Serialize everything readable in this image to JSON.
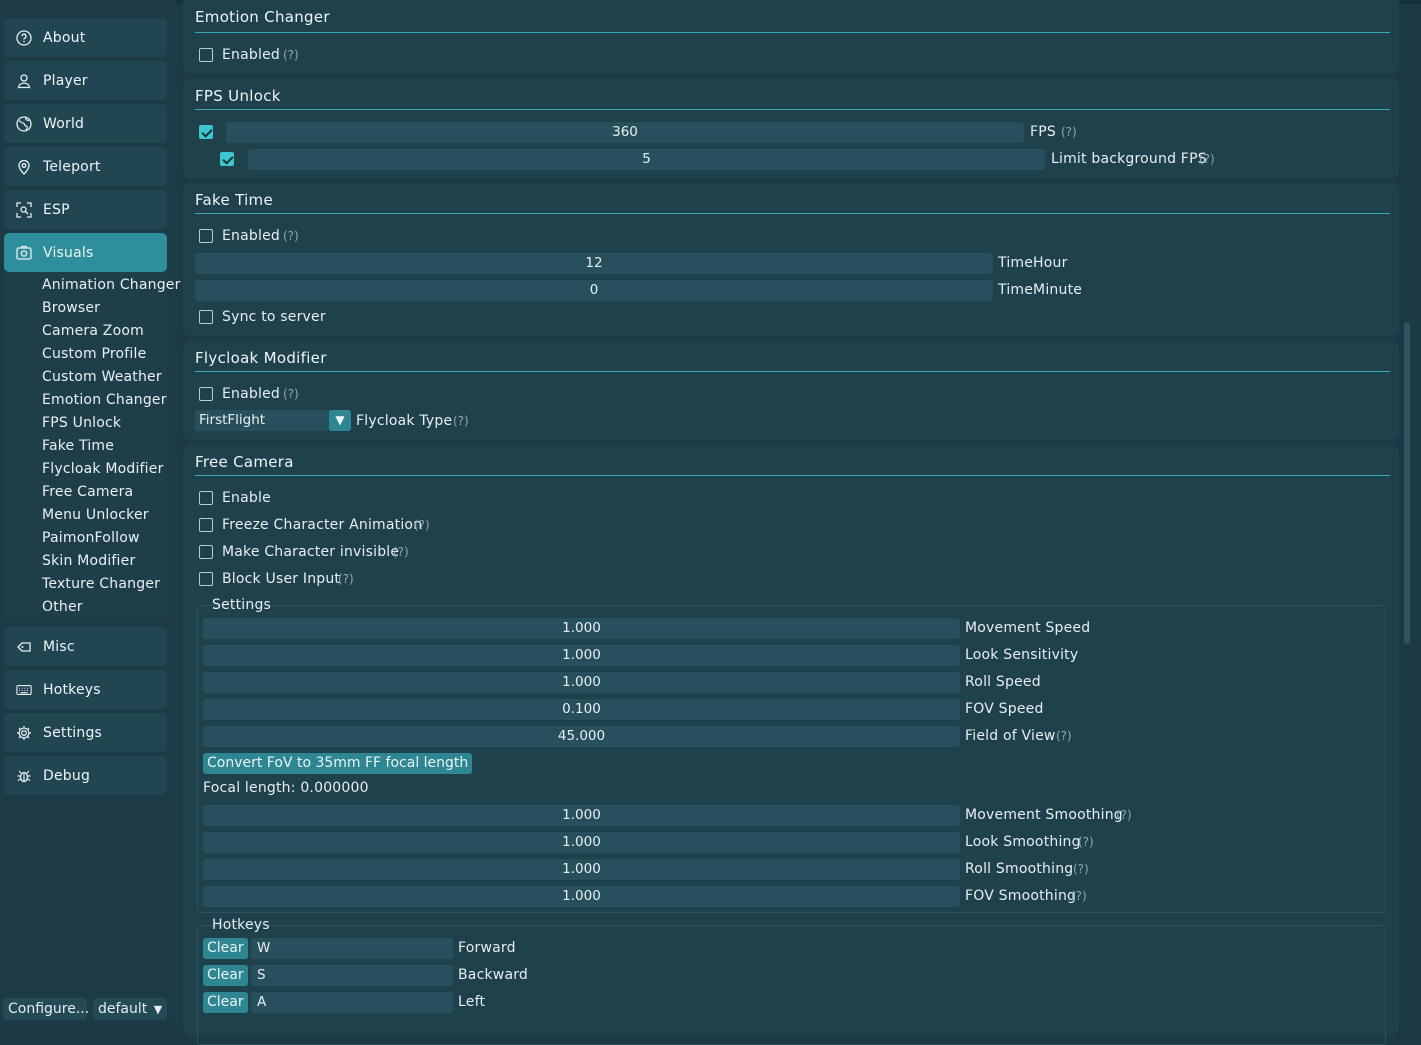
{
  "sidebar": {
    "nav": [
      {
        "label": "About",
        "icon": "help-circle-icon"
      },
      {
        "label": "Player",
        "icon": "user-icon"
      },
      {
        "label": "World",
        "icon": "globe-icon"
      },
      {
        "label": "Teleport",
        "icon": "map-pin-icon"
      },
      {
        "label": "ESP",
        "icon": "scan-icon"
      },
      {
        "label": "Visuals",
        "icon": "image-icon",
        "active": true
      }
    ],
    "visuals_items": [
      "Animation Changer",
      "Browser",
      "Camera Zoom",
      "Custom Profile",
      "Custom Weather",
      "Emotion Changer",
      "FPS Unlock",
      "Fake Time",
      "Flycloak Modifier",
      "Free Camera",
      "Menu Unlocker",
      "PaimonFollow",
      "Skin Modifier",
      "Texture Changer",
      "Other"
    ],
    "nav_bottom": [
      {
        "label": "Misc",
        "icon": "tag-icon"
      },
      {
        "label": "Hotkeys",
        "icon": "keyboard-icon"
      },
      {
        "label": "Settings",
        "icon": "gear-icon"
      },
      {
        "label": "Debug",
        "icon": "bug-icon"
      }
    ],
    "configure_label": "Configure...",
    "profile_value": "default"
  },
  "help_mark": "(?)",
  "emotion_changer": {
    "title": "Emotion Changer",
    "enabled_label": "Enabled",
    "enabled": false
  },
  "fps_unlock": {
    "title": "FPS Unlock",
    "fps_value": "360",
    "fps_label": "FPS",
    "fps_checked": true,
    "bg_value": "5",
    "bg_label": "Limit background FPS",
    "bg_checked": true
  },
  "fake_time": {
    "title": "Fake Time",
    "enabled_label": "Enabled",
    "enabled": false,
    "hour_value": "12",
    "hour_label": "TimeHour",
    "minute_value": "0",
    "minute_label": "TimeMinute",
    "sync_label": "Sync to server",
    "sync": false
  },
  "flycloak": {
    "title": "Flycloak Modifier",
    "enabled_label": "Enabled",
    "enabled": false,
    "type_value": "FirstFlight",
    "type_label": "Flycloak Type"
  },
  "free_camera": {
    "title": "Free Camera",
    "enable_label": "Enable",
    "freeze_label": "Freeze Character Animation",
    "invisible_label": "Make Character invisible",
    "block_label": "Block User Input",
    "settings_title": "Settings",
    "speed_rows": [
      {
        "value": "1.000",
        "label": "Movement Speed",
        "help": false
      },
      {
        "value": "1.000",
        "label": "Look Sensitivity",
        "help": false
      },
      {
        "value": "1.000",
        "label": "Roll Speed",
        "help": false
      },
      {
        "value": "0.100",
        "label": "FOV Speed",
        "help": false
      },
      {
        "value": "45.000",
        "label": "Field of View",
        "help": true
      }
    ],
    "convert_button": "Convert FoV to 35mm FF focal length",
    "focal_text": "Focal length: 0.000000",
    "smooth_rows": [
      {
        "value": "1.000",
        "label": "Movement Smoothing"
      },
      {
        "value": "1.000",
        "label": "Look Smoothing"
      },
      {
        "value": "1.000",
        "label": "Roll Smoothing"
      },
      {
        "value": "1.000",
        "label": "FOV Smoothing"
      }
    ],
    "hotkeys_title": "Hotkeys",
    "hotkeys": [
      {
        "clear": "Clear",
        "key": "W",
        "label": "Forward"
      },
      {
        "clear": "Clear",
        "key": "S",
        "label": "Backward"
      },
      {
        "clear": "Clear",
        "key": "A",
        "label": "Left"
      }
    ]
  }
}
